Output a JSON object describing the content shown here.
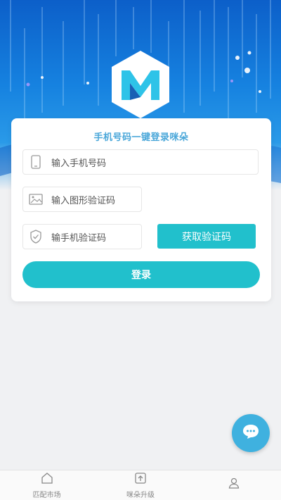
{
  "login": {
    "title": "手机号码一键登录咪朵",
    "phone_placeholder": "输入手机号码",
    "captcha_placeholder": "输入图形验证码",
    "sms_placeholder": "输手机验证码",
    "get_code_label": "获取验证码",
    "login_label": "登录"
  },
  "tabbar": {
    "items": [
      {
        "label": "匹配市场",
        "icon": "home-icon"
      },
      {
        "label": "咪朵升级",
        "icon": "upgrade-icon"
      },
      {
        "label": "",
        "icon": "user-icon"
      }
    ]
  },
  "colors": {
    "accent": "#21c0cc",
    "hero_blue": "#1682e0",
    "title_blue": "#4aa7d9",
    "fab": "#3fb1df"
  }
}
